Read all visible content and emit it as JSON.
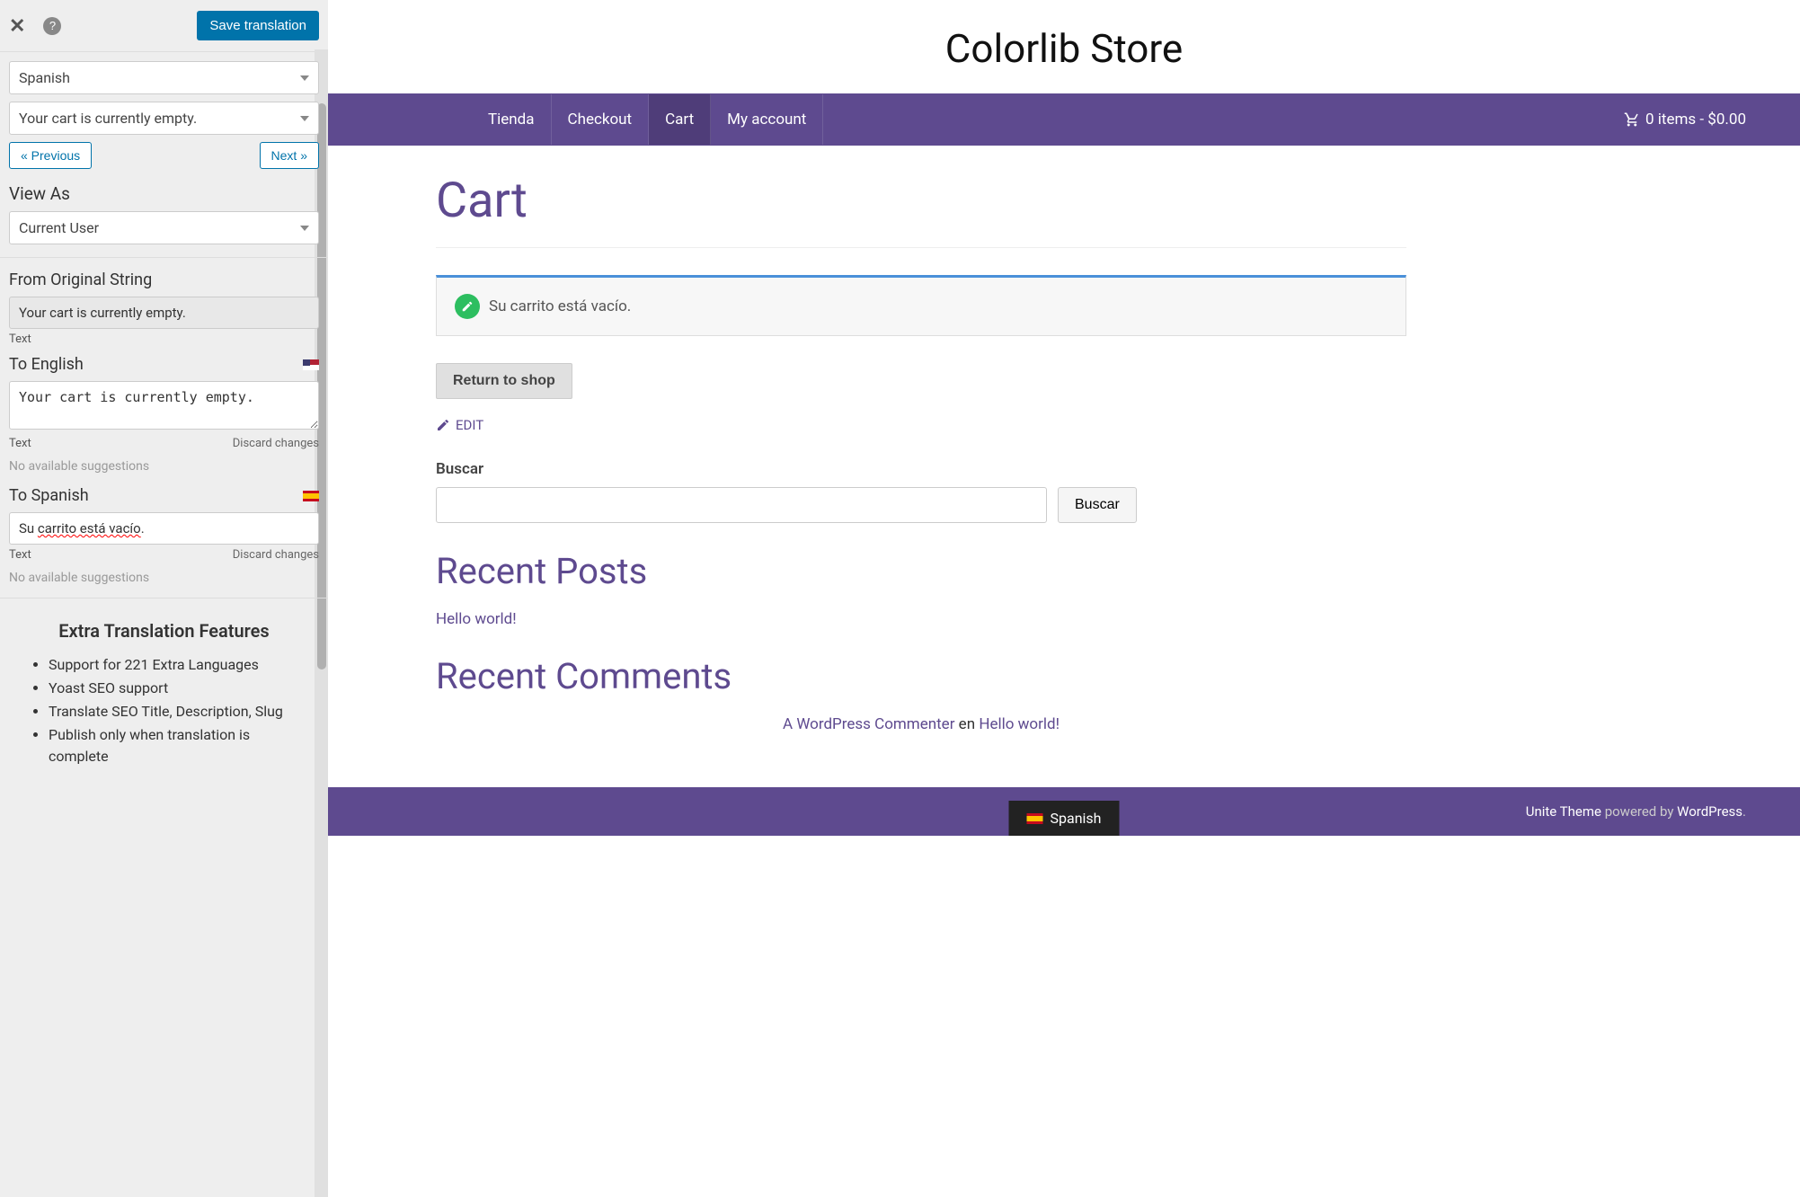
{
  "sidebar": {
    "save_button": "Save translation",
    "language_select": "Spanish",
    "string_select": "Your cart is currently empty.",
    "prev_button": "« Previous",
    "next_button": "Next »",
    "view_as_label": "View As",
    "view_as_value": "Current User",
    "from_original_label": "From Original String",
    "from_original_value": "Your cart is currently empty.",
    "text_label": "Text",
    "to_english_label": "To English",
    "to_english_value": "Your cart is currently empty.",
    "discard_changes": "Discard changes",
    "no_suggestions": "No available suggestions",
    "to_spanish_label": "To Spanish",
    "to_spanish_prefix": "Su ",
    "to_spanish_underlined": "carrito está vacío",
    "to_spanish_suffix": ".",
    "features": {
      "title": "Extra Translation Features",
      "items": [
        "Support for 221 Extra Languages",
        "Yoast SEO support",
        "Translate SEO Title, Description, Slug",
        "Publish only when translation is complete"
      ]
    }
  },
  "preview": {
    "site_title": "Colorlib Store",
    "nav": {
      "items": [
        "Tienda",
        "Checkout",
        "Cart",
        "My account"
      ],
      "active_index": 2,
      "cart_summary": "0 items - $0.00"
    },
    "page_title": "Cart",
    "empty_notice": "Su carrito está vacío.",
    "return_button": "Return to shop",
    "edit_link": "EDIT",
    "search": {
      "label": "Buscar",
      "button": "Buscar"
    },
    "recent_posts": {
      "title": "Recent Posts",
      "items": [
        "Hello world!"
      ]
    },
    "recent_comments": {
      "title": "Recent Comments",
      "author": "A WordPress Commenter",
      "on": " en ",
      "post": "Hello world!"
    },
    "footer": {
      "theme": "Unite Theme",
      "powered": " powered by ",
      "platform": "WordPress",
      "lang_switcher": "Spanish"
    }
  }
}
